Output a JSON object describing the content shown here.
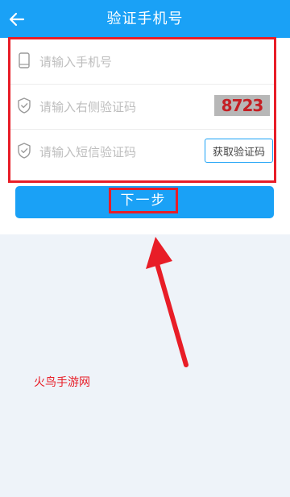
{
  "header": {
    "title": "验证手机号",
    "back_icon": "arrow-left-icon"
  },
  "form": {
    "phone": {
      "icon": "phone-icon",
      "placeholder": "请输入手机号",
      "value": ""
    },
    "image_code": {
      "icon": "shield-check-icon",
      "placeholder": "请输入右侧验证码",
      "value": "",
      "captcha_text": "8723"
    },
    "sms_code": {
      "icon": "shield-check-icon",
      "placeholder": "请输入短信验证码",
      "value": "",
      "button_label": "获取验证码"
    }
  },
  "next_button": {
    "label": "下一步"
  },
  "annotation": {
    "arrow_icon": "red-arrow-icon",
    "highlight_color": "#e81d27"
  },
  "watermark": {
    "text": "火鸟手游网"
  },
  "colors": {
    "accent": "#1aa1f6",
    "highlight": "#e81d27",
    "page_background": "#eef3f9"
  }
}
